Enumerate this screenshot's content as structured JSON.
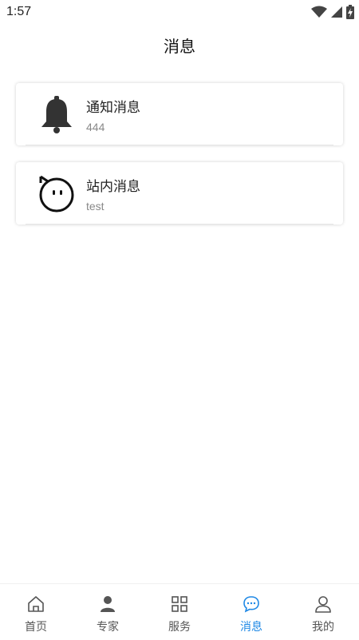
{
  "status_bar": {
    "time": "1:57",
    "icons": [
      "wifi-icon",
      "signal-icon",
      "battery-icon"
    ]
  },
  "header": {
    "title": "消息"
  },
  "messages": [
    {
      "title": "通知消息",
      "subtitle": "444",
      "icon": "bell-icon"
    },
    {
      "title": "站内消息",
      "subtitle": "test",
      "icon": "chat-face-icon"
    }
  ],
  "tabbar": {
    "active_color": "#1e88e5",
    "inactive_color": "#555555",
    "items": [
      {
        "label": "首页",
        "icon": "home-icon",
        "active": false
      },
      {
        "label": "专家",
        "icon": "person-icon",
        "active": false
      },
      {
        "label": "服务",
        "icon": "grid-icon",
        "active": false
      },
      {
        "label": "消息",
        "icon": "message-bubble-icon",
        "active": true
      },
      {
        "label": "我的",
        "icon": "user-outline-icon",
        "active": false
      }
    ]
  }
}
